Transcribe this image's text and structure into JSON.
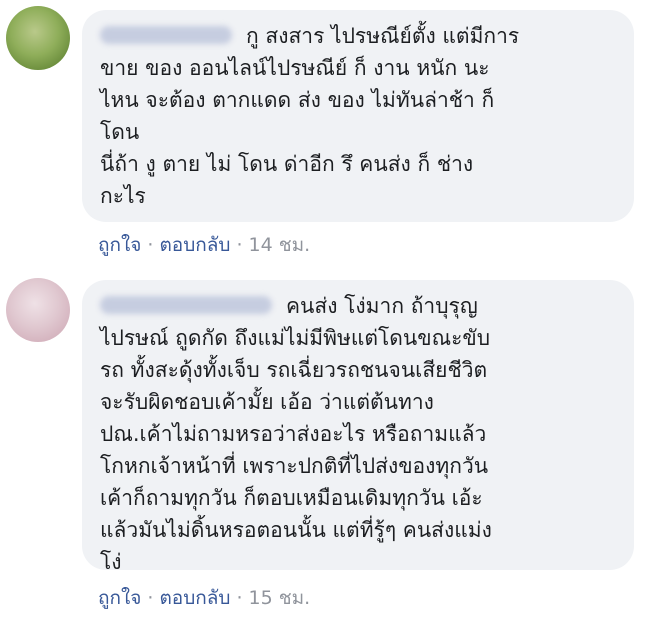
{
  "comments": [
    {
      "text": "กู สงสาร ไปรษณีย์ตั้ง แต่มีการ\nขาย ของ ออนไลน์ไปรษณีย์ ก็ งาน หนัก นะ\nไหน จะต้อง ตากแดด ส่ง ของ ไม่ทันล่าช้า ก็\nโดน\nนี่ถ้า งู ตาย ไม่ โดน ด่าอีก รึ คนส่ง ก็ ช่าง\nกะไร",
      "like_label": "ถูกใจ",
      "reply_label": "ตอบกลับ",
      "timestamp": "14 ชม."
    },
    {
      "text": "คนส่ง โง่มาก ถ้าบุรุญ\nไปรษณ์ ถูดกัด ถึงแม่ไม่มีพิษแต่โดนขณะขับ\nรถ ทั้งสะดุ้งทั้งเจ็บ รถเฉี่ยวรถชนจนเสียชีวิต\nจะรับผิดชอบเค้ามั้ย เอ้อ ว่าแต่ต้นทาง\nปณ.เค้าไม่ถามหรอว่าส่งอะไร หรือถามแล้ว\nโกหกเจ้าหน้าที่ เพราะปกติที่ไปส่งของทุกวัน\nเค้าก็ถามทุกวัน ก็ตอบเหมือนเดิมทุกวัน เอ้ะ\nแล้วมันไม่ดิ้นหรอตอนนั้น แต่ที่รู้ๆ คนส่งแม่ง\nโง่",
      "like_label": "ถูกใจ",
      "reply_label": "ตอบกลับ",
      "timestamp": "15 ชม."
    }
  ],
  "separator": "·",
  "colors": {
    "bubble": "#f0f2f5",
    "text": "#1c1e21",
    "link": "#385898",
    "muted": "#90949c"
  }
}
